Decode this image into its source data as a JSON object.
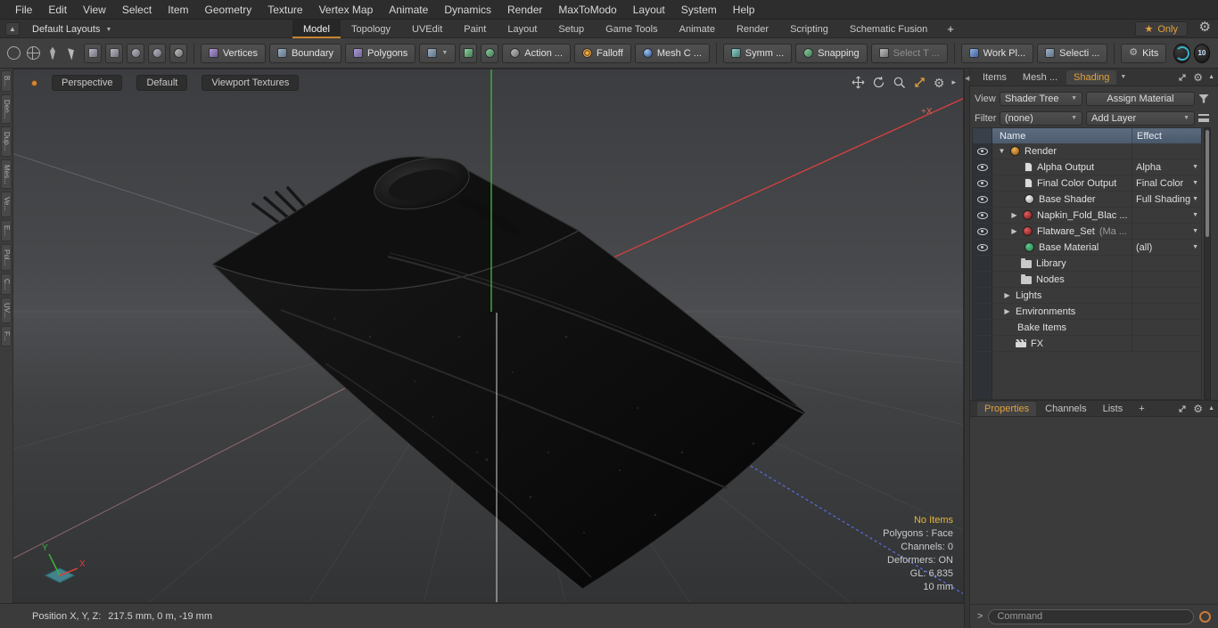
{
  "menubar": {
    "items": [
      "File",
      "Edit",
      "View",
      "Select",
      "Item",
      "Geometry",
      "Texture",
      "Vertex Map",
      "Animate",
      "Dynamics",
      "Render",
      "MaxToModo",
      "Layout",
      "System",
      "Help"
    ]
  },
  "layout_bar": {
    "preset": "Default Layouts",
    "tabs": [
      "Model",
      "Topology",
      "UVEdit",
      "Paint",
      "Layout",
      "Setup",
      "Game Tools",
      "Animate",
      "Render",
      "Scripting",
      "Schematic Fusion"
    ],
    "add_tab": "+",
    "only_star": "★",
    "only": "Only"
  },
  "toolbar": {
    "vertices": "Vertices",
    "boundary": "Boundary",
    "polygons": "Polygons",
    "action": "Action  ...",
    "falloff": "Falloff",
    "mesh_c": "Mesh C ...",
    "symm": "Symm ...",
    "snapping": "Snapping",
    "select_t": "Select T ...",
    "work_pl": "Work Pl...",
    "selecti": "Selecti ...",
    "kits": "Kits"
  },
  "left_tabs": [
    "B...",
    "Den...",
    "Dup...",
    "Mes...",
    "Ve...",
    "E...",
    "Pol...",
    "C...",
    "UV...",
    "F..."
  ],
  "viewport": {
    "tabs": [
      "Perspective",
      "Default",
      "Viewport Textures"
    ],
    "axis_plus_x": "+X",
    "gizmo_y": "Y",
    "gizmo_x": "X",
    "stats": [
      "No Items",
      "Polygons : Face",
      "Channels: 0",
      "Deformers: ON",
      "GL: 6,835",
      "10 mm"
    ]
  },
  "status_bar": {
    "label": "Position X, Y, Z:",
    "value": "217.5 mm, 0 m, -19 mm"
  },
  "right_panel": {
    "tabs": [
      "Items",
      "Mesh ...",
      "Shading"
    ],
    "view_label": "View",
    "view_value": "Shader Tree",
    "assign_button": "Assign Material",
    "filter_label": "Filter",
    "filter_value": "(none)",
    "add_layer": "Add Layer",
    "tree": {
      "name_header": "Name",
      "effect_header": "Effect",
      "rows": [
        {
          "name": "Render",
          "effect": ""
        },
        {
          "name": "Alpha Output",
          "effect": "Alpha"
        },
        {
          "name": "Final Color Output",
          "effect": "Final Color"
        },
        {
          "name": "Base Shader",
          "effect": "Full Shading"
        },
        {
          "name": "Napkin_Fold_Blac ...",
          "effect": ""
        },
        {
          "name": "Flatware_Set",
          "suffix": "(Ma ...",
          "effect": ""
        },
        {
          "name": "Base Material",
          "effect": "(all)"
        },
        {
          "name": "Library",
          "effect": ""
        },
        {
          "name": "Nodes",
          "effect": ""
        },
        {
          "name": "Lights",
          "effect": ""
        },
        {
          "name": "Environments",
          "effect": ""
        },
        {
          "name": "Bake Items",
          "effect": ""
        },
        {
          "name": "FX",
          "effect": ""
        }
      ]
    },
    "bottom_tabs": [
      "Properties",
      "Channels",
      "Lists",
      "+"
    ],
    "command": {
      "prompt": ">",
      "placeholder": "Command"
    }
  },
  "colors": {
    "accent": "#e2a13c",
    "axis_green": "#3cb43c",
    "axis_red": "#d84040",
    "axis_blue": "#5a6ad8",
    "material_red": "#c23434",
    "material_green": "#3fae6a"
  }
}
